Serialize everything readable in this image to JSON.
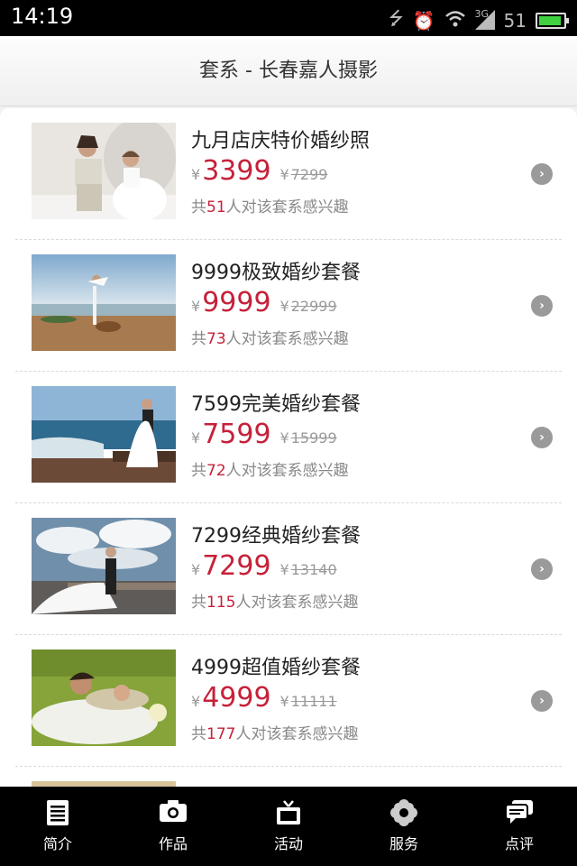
{
  "status": {
    "time": "14:19",
    "signal_label": "3G",
    "battery_text": "51"
  },
  "header": {
    "title": "套系 - 长春嘉人摄影"
  },
  "currency": "¥",
  "interest": {
    "prefix": "共",
    "suffix": "人对该套系感兴趣"
  },
  "items": [
    {
      "name": "九月店庆特价婚纱照",
      "price": "3399",
      "original": "7299",
      "count": "51",
      "photo": "studio-couple"
    },
    {
      "name": "9999极致婚纱套餐",
      "price": "9999",
      "original": "22999",
      "count": "73",
      "photo": "beach-lift"
    },
    {
      "name": "7599完美婚纱套餐",
      "price": "7599",
      "original": "15999",
      "count": "72",
      "photo": "seaside-pier"
    },
    {
      "name": "7299经典婚纱套餐",
      "price": "7299",
      "original": "13140",
      "count": "115",
      "photo": "cloudy-dock"
    },
    {
      "name": "4999超值婚纱套餐",
      "price": "4999",
      "original": "11111",
      "count": "177",
      "photo": "grass-lying"
    }
  ],
  "tabs": [
    {
      "label": "简介",
      "icon": "document-icon"
    },
    {
      "label": "作品",
      "icon": "camera-icon"
    },
    {
      "label": "活动",
      "icon": "tv-icon"
    },
    {
      "label": "服务",
      "icon": "flower-icon"
    },
    {
      "label": "点评",
      "icon": "chat-icon"
    }
  ],
  "colors": {
    "price": "#c6213a",
    "tabbar": "#000000",
    "statusbar": "#000000"
  }
}
